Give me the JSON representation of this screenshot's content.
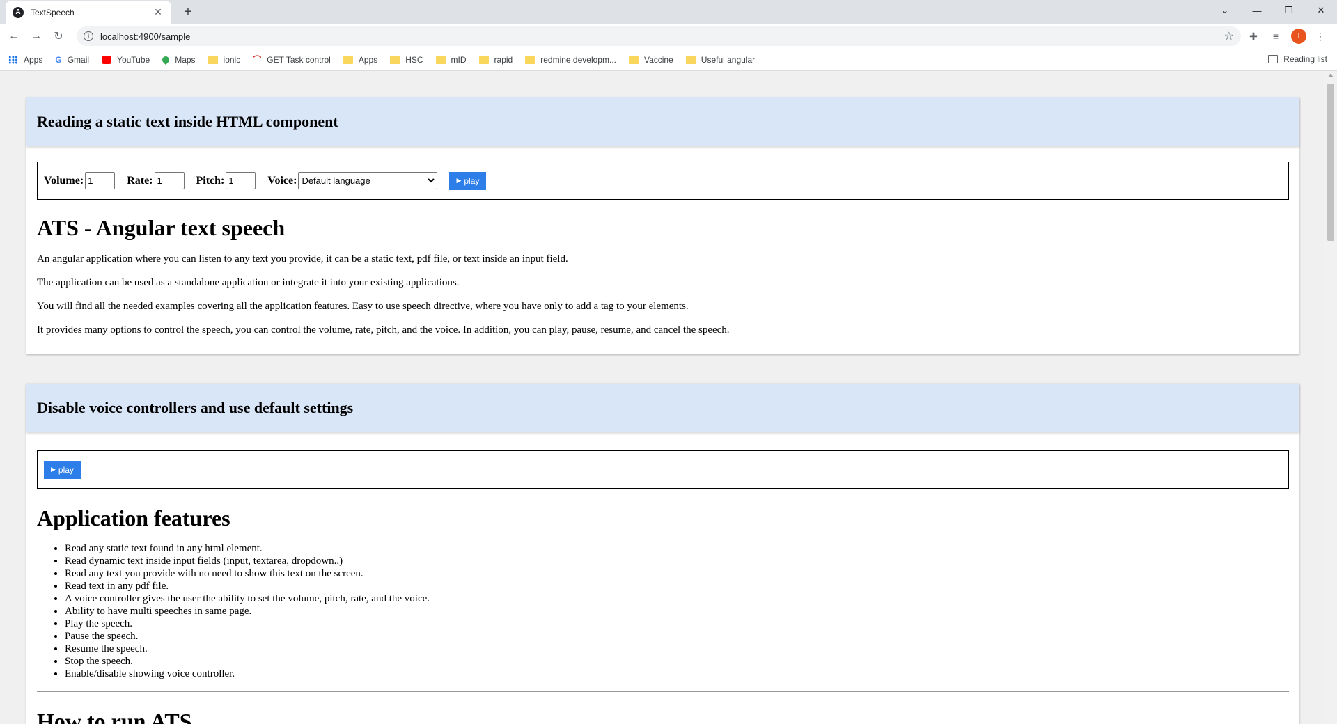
{
  "browser": {
    "tab_title": "TextSpeech",
    "tab_close": "✕",
    "new_tab": "+",
    "url": "localhost:4900/sample",
    "window_controls": [
      "⌄",
      "—",
      "❐",
      "✕"
    ],
    "bookmarks": [
      {
        "label": "Apps",
        "icon": "apps-icon"
      },
      {
        "label": "Gmail",
        "icon": "google-icon"
      },
      {
        "label": "YouTube",
        "icon": "youtube-icon"
      },
      {
        "label": "Maps",
        "icon": "maps-icon"
      },
      {
        "label": "ionic",
        "icon": "folder-icon"
      },
      {
        "label": "GET Task control",
        "icon": "task-control-icon"
      },
      {
        "label": "Apps",
        "icon": "folder-icon"
      },
      {
        "label": "HSC",
        "icon": "folder-icon"
      },
      {
        "label": "mID",
        "icon": "folder-icon"
      },
      {
        "label": "rapid",
        "icon": "folder-icon"
      },
      {
        "label": "redmine developm...",
        "icon": "folder-icon"
      },
      {
        "label": "Vaccine",
        "icon": "folder-icon"
      },
      {
        "label": "Useful angular",
        "icon": "folder-icon"
      }
    ],
    "reading_list": "Reading list",
    "profile_initial": "I"
  },
  "section1": {
    "header": "Reading a static text inside HTML component",
    "volume_label": "Volume:",
    "volume_value": "1",
    "rate_label": "Rate:",
    "rate_value": "1",
    "pitch_label": "Pitch:",
    "pitch_value": "1",
    "voice_label": "Voice:",
    "voice_selected": "Default language",
    "play_label": "play",
    "title": "ATS - Angular text speech",
    "paragraphs": [
      "An angular application where you can listen to any text you provide, it can be a static text, pdf file, or text inside an input field.",
      "The application can be used as a standalone application or integrate it into your existing applications.",
      "You will find all the needed examples covering all the application features. Easy to use speech directive, where you have only to add a tag to your elements.",
      "It provides many options to control the speech, you can control the volume, rate, pitch, and the voice. In addition, you can play, pause, resume, and cancel the speech."
    ]
  },
  "section2": {
    "header": "Disable voice controllers and use default settings",
    "play_label": "play",
    "title": "Application features",
    "features": [
      "Read any static text found in any html element.",
      "Read dynamic text inside input fields (input, textarea, dropdown..)",
      "Read any text you provide with no need to show this text on the screen.",
      "Read text in any pdf file.",
      "A voice controller gives the user the ability to set the volume, pitch, rate, and the voice.",
      "Ability to have multi speeches in same page.",
      "Play the speech.",
      "Pause the speech.",
      "Resume the speech.",
      "Stop the speech.",
      "Enable/disable showing voice controller."
    ],
    "next_title": "How to run ATS"
  },
  "colors": {
    "header_bg": "#d9e6f8",
    "play_button": "#2d7ee8",
    "profile": "#e8541e"
  }
}
